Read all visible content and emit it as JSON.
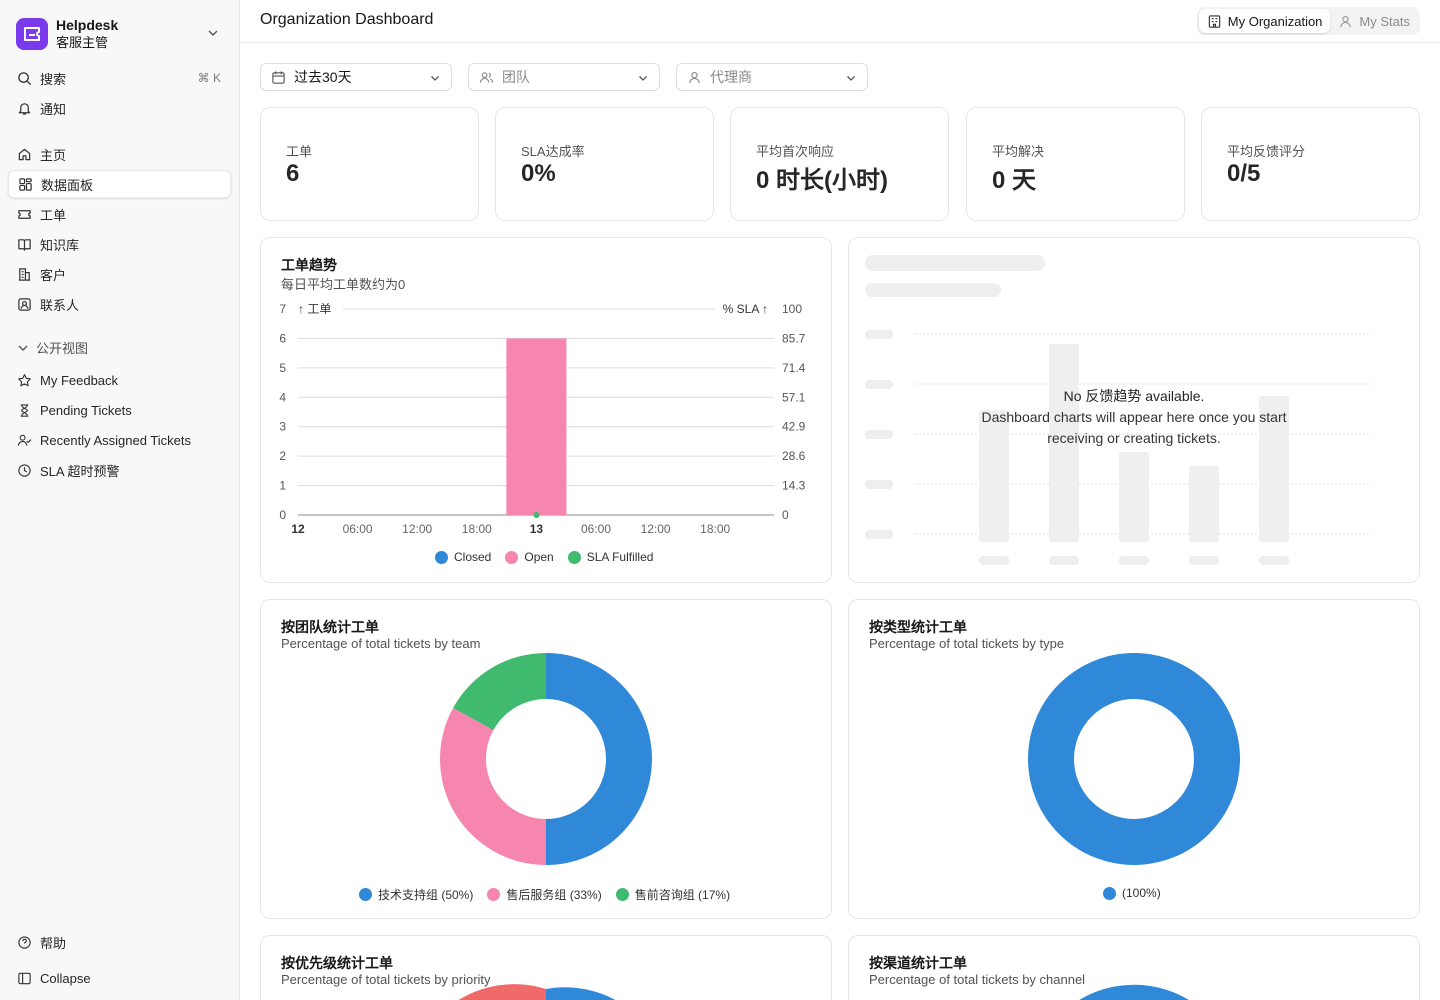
{
  "brand": {
    "title": "Helpdesk",
    "subtitle": "客服主管"
  },
  "sidebar": {
    "search": {
      "label": "搜索",
      "shortcut": "⌘ K"
    },
    "notifications": "通知",
    "nav": [
      {
        "label": "主页",
        "icon": "home-icon"
      },
      {
        "label": "数据面板",
        "icon": "dashboard-icon",
        "active": true
      },
      {
        "label": "工单",
        "icon": "ticket-icon"
      },
      {
        "label": "知识库",
        "icon": "book-icon"
      },
      {
        "label": "客户",
        "icon": "building-icon"
      },
      {
        "label": "联系人",
        "icon": "contact-icon"
      }
    ],
    "public_views_label": "公开视图",
    "views": [
      {
        "label": "My Feedback",
        "icon": "star-icon"
      },
      {
        "label": "Pending Tickets",
        "icon": "hourglass-icon"
      },
      {
        "label": "Recently Assigned Tickets",
        "icon": "user-check-icon"
      },
      {
        "label": "SLA 超时预警",
        "icon": "clock-icon"
      }
    ],
    "help": "帮助",
    "collapse": "Collapse"
  },
  "header": {
    "title": "Organization Dashboard",
    "tabs": [
      {
        "label": "My Organization",
        "active": true
      },
      {
        "label": "My Stats",
        "active": false
      }
    ]
  },
  "filters": {
    "period": "过去30天",
    "team_placeholder": "团队",
    "agent_placeholder": "代理商"
  },
  "stats": [
    {
      "label": "工单",
      "value": "6"
    },
    {
      "label": "SLA达成率",
      "value": "0%"
    },
    {
      "label": "平均首次响应",
      "value": "0 时长(小时)"
    },
    {
      "label": "平均解决",
      "value": "0 天"
    },
    {
      "label": "平均反馈评分",
      "value": "0/5"
    }
  ],
  "trend": {
    "title": "工单趋势",
    "subtitle": "每日平均工单数约为0",
    "left_axis_label": "↑ 工单",
    "right_axis_label": "% SLA ↑",
    "legend": [
      "Closed",
      "Open",
      "SLA Fulfilled"
    ]
  },
  "feedback": {
    "empty_title": "No 反馈趋势 available.",
    "empty_body": "Dashboard charts will appear here once you start receiving or creating tickets."
  },
  "team_card": {
    "title": "按团队统计工单",
    "subtitle": "Percentage of total tickets by team"
  },
  "type_card": {
    "title": "按类型统计工单",
    "subtitle": "Percentage of total tickets by type"
  },
  "priority_card": {
    "title": "按优先级统计工单",
    "subtitle": "Percentage of total tickets by priority"
  },
  "channel_card": {
    "title": "按渠道统计工单",
    "subtitle": "Percentage of total tickets by channel"
  },
  "colors": {
    "closed": "#2f88d8",
    "open": "#f685b0",
    "sla": "#3fba6e",
    "brand": "#7c3aed"
  },
  "chart_data": [
    {
      "type": "bar",
      "title": "工单趋势",
      "subtitle": "每日平均工单数约为0",
      "ylabel": "工单",
      "y2label": "% SLA",
      "x_ticks": [
        "12",
        "06:00",
        "12:00",
        "18:00",
        "13",
        "06:00",
        "12:00",
        "18:00"
      ],
      "ylim": [
        0,
        7
      ],
      "y_ticks": [
        0,
        1,
        2,
        3,
        4,
        5,
        6,
        7
      ],
      "y2lim": [
        0,
        100
      ],
      "y2_ticks": [
        "0",
        "14.3",
        "28.6",
        "42.9",
        "57.1",
        "71.4",
        "85.7",
        "100"
      ],
      "series": [
        {
          "name": "Closed",
          "color": "#2f88d8",
          "values": [
            {
              "x": "13",
              "y": 0
            }
          ]
        },
        {
          "name": "Open",
          "color": "#f685b0",
          "values": [
            {
              "x": "13",
              "y": 6
            }
          ]
        },
        {
          "name": "SLA Fulfilled",
          "color": "#3fba6e",
          "values": [
            {
              "x": "13",
              "y": 0
            }
          ]
        }
      ],
      "legend": "bottom",
      "grid": true
    },
    {
      "type": "pie",
      "title": "按团队统计工单",
      "subtitle": "Percentage of total tickets by team",
      "donut": true,
      "slices": [
        {
          "label": "技术支持组 (50%)",
          "value": 50,
          "color": "#2f88d8"
        },
        {
          "label": "售后服务组 (33%)",
          "value": 33,
          "color": "#f685b0"
        },
        {
          "label": "售前咨询组 (17%)",
          "value": 17,
          "color": "#3fba6e"
        }
      ],
      "legend": "bottom"
    },
    {
      "type": "pie",
      "title": "按类型统计工单",
      "subtitle": "Percentage of total tickets by type",
      "donut": true,
      "slices": [
        {
          "label": "(100%)",
          "value": 100,
          "color": "#2f88d8"
        }
      ],
      "legend": "bottom"
    }
  ]
}
